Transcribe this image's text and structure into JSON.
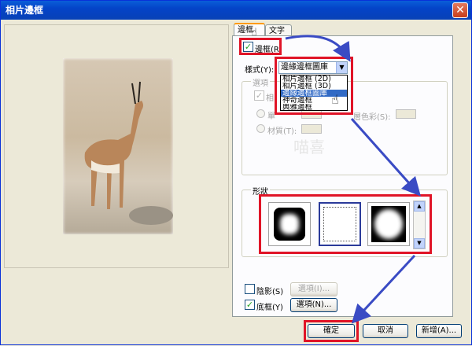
{
  "window": {
    "title": "相片邊框",
    "close_glyph": "✕"
  },
  "tabs": [
    {
      "label": "邊框"
    },
    {
      "label": "文字"
    }
  ],
  "border_checkbox": {
    "label": "邊框(R)",
    "checked": true
  },
  "style": {
    "label": "樣式(Y):",
    "selected": "邊緣邊框圖庫",
    "options": [
      "相片邊框 (2D)",
      "相片邊框 (3D)",
      "邊緣邊框圖庫",
      "神奇邊框",
      "典雅邊框"
    ],
    "selected_index": 2
  },
  "options_group": {
    "label": "選項",
    "checkbox_label": "相",
    "radio1_label": "單",
    "color_label": "層色彩(S):",
    "radio2_label": "材質(T):"
  },
  "shape_group": {
    "label": "形狀"
  },
  "shadow": {
    "label": "陰影(S)",
    "checked": false,
    "options_label": "選項(I)..."
  },
  "backing": {
    "label": "底框(Y)",
    "checked": true,
    "options_label": "選項(N)..."
  },
  "buttons": {
    "ok": "確定",
    "cancel": "取消",
    "new": "新增(A)..."
  },
  "watermark": "喵喜"
}
